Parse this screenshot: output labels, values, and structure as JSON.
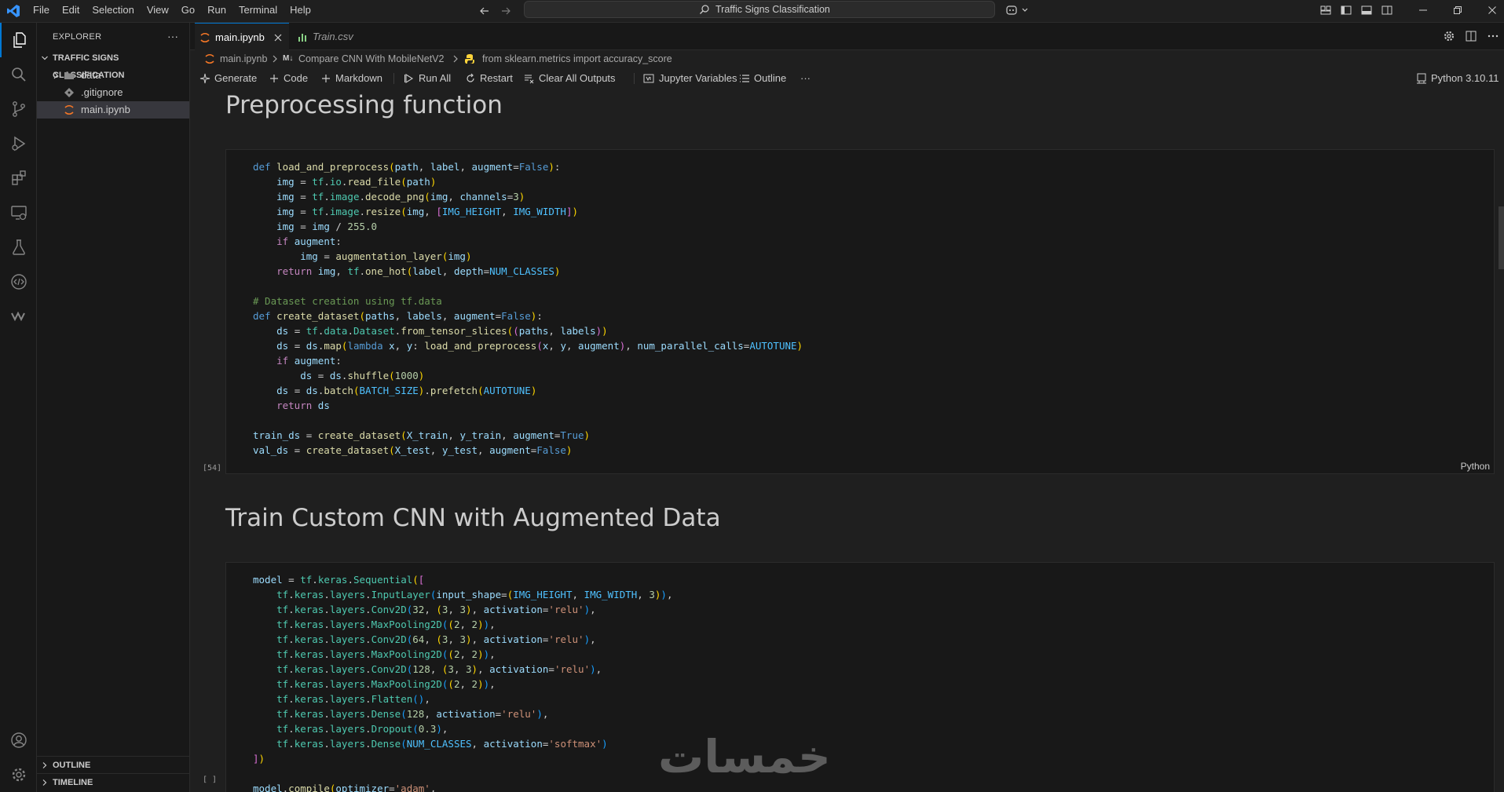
{
  "menu": [
    "File",
    "Edit",
    "Selection",
    "View",
    "Go",
    "Run",
    "Terminal",
    "Help"
  ],
  "search": {
    "text": "Traffic Signs Classification"
  },
  "explorer": {
    "title": "EXPLORER",
    "more": "···",
    "folder": "TRAFFIC SIGNS CLASSIFICATION",
    "items": [
      {
        "label": "data",
        "type": "folder"
      },
      {
        "label": ".gitignore",
        "type": "file"
      },
      {
        "label": "main.ipynb",
        "type": "notebook"
      }
    ],
    "outline": "OUTLINE",
    "timeline": "TIMELINE"
  },
  "tabs": [
    {
      "label": "main.ipynb",
      "active": true
    },
    {
      "label": "Train.csv",
      "active": false
    }
  ],
  "breadcrumb": [
    "main.ipynb",
    "Compare CNN With MobileNetV2",
    "from sklearn.metrics import accuracy_score"
  ],
  "breadcrumb_badge": "M↓",
  "toolbar": {
    "generate": "Generate",
    "code": "Code",
    "markdown": "Markdown",
    "run_all": "Run All",
    "restart": "Restart",
    "clear_outputs": "Clear All Outputs",
    "variables": "Jupyter Variables",
    "outline": "Outline",
    "more": "···",
    "kernel": "Python 3.10.11"
  },
  "cells": [
    {
      "heading": "Preprocessing function"
    },
    {
      "exec_count": "[54]",
      "language": "Python"
    },
    {
      "heading": "Train Custom CNN with Augmented Data"
    },
    {
      "exec_count": "[ ]"
    }
  ],
  "watermark": "خمسات",
  "colors": {
    "accent": "#0078d4",
    "background": "#1f1f1f",
    "sidebar": "#181818"
  }
}
